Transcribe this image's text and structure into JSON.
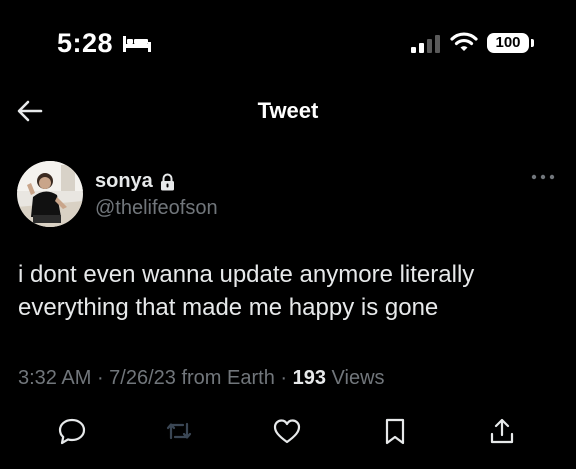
{
  "status_bar": {
    "time": "5:28",
    "battery_level": "100",
    "signal_bars_active": 2,
    "icons": [
      "bed-icon",
      "signal-icon",
      "wifi-icon",
      "battery-icon"
    ]
  },
  "header": {
    "title": "Tweet",
    "back_icon": "arrow-left-icon"
  },
  "tweet": {
    "display_name": "sonya",
    "protected": true,
    "handle": "@thelifeofson",
    "text": "i dont even wanna update anymore literally everything that made me happy is gone",
    "time": "3:32 AM",
    "date": "7/26/23",
    "source": "from Earth",
    "separator": " · ",
    "views_count": "193",
    "views_label": "Views"
  },
  "actions": [
    {
      "name": "reply",
      "icon": "reply-icon"
    },
    {
      "name": "retweet",
      "icon": "retweet-icon"
    },
    {
      "name": "like",
      "icon": "heart-icon"
    },
    {
      "name": "bookmark",
      "icon": "bookmark-icon"
    },
    {
      "name": "share",
      "icon": "share-icon"
    }
  ],
  "colors": {
    "background": "#000000",
    "text_primary": "#e7e9ea",
    "text_secondary": "#71767b",
    "retweet_disabled": "#3a4654"
  }
}
